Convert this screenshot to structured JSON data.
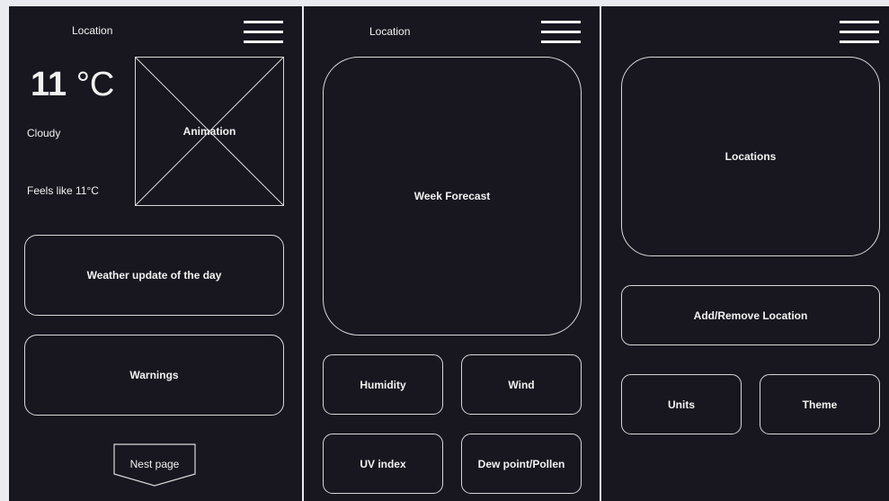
{
  "screen1": {
    "location_label": "Location",
    "temperature_value": "11",
    "temperature_unit": "°C",
    "condition": "Cloudy",
    "feels_like": "Feels like 11°C",
    "animation_label": "Animation",
    "daily_update_label": "Weather update of the day",
    "warnings_label": "Warnings",
    "next_page_label": "Nest page"
  },
  "screen2": {
    "location_label": "Location",
    "week_forecast_label": "Week Forecast",
    "humidity_label": "Humidity",
    "wind_label": "Wind",
    "uv_index_label": "UV index",
    "dew_point_label": "Dew point/Pollen"
  },
  "screen3": {
    "locations_label": "Locations",
    "add_remove_label": "Add/Remove Location",
    "units_label": "Units",
    "theme_label": "Theme"
  },
  "colors": {
    "background": "#e9ebf0",
    "screen": "#18161f",
    "foreground": "#f2f2f2",
    "outline": "#d8d8d8"
  }
}
